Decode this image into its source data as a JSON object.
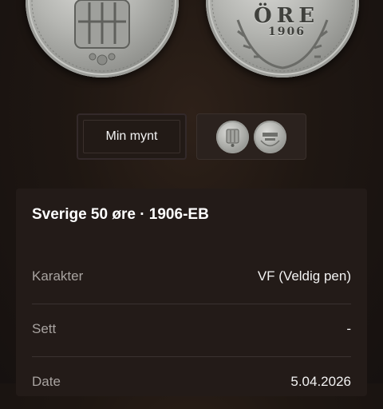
{
  "viewer": {
    "coin_obverse_icon": "coin-obverse-image",
    "coin_reverse_icon": "coin-reverse-image",
    "reverse_legend": "ÖRE",
    "reverse_year": "1906"
  },
  "toggle": {
    "my_coin_label": "Min mynt",
    "thumbnail_icon": "coin-thumbnails"
  },
  "details": {
    "title": "Sverige 50 øre · 1906-EB",
    "rows": [
      {
        "label": "Karakter",
        "value": "VF (Veldig pen)"
      },
      {
        "label": "Sett",
        "value": "-"
      },
      {
        "label": "Date",
        "value": "5.04.2026"
      }
    ]
  },
  "colors": {
    "background": "#1f1712",
    "card": "#231b18",
    "label_text": "#a8a3a0"
  }
}
